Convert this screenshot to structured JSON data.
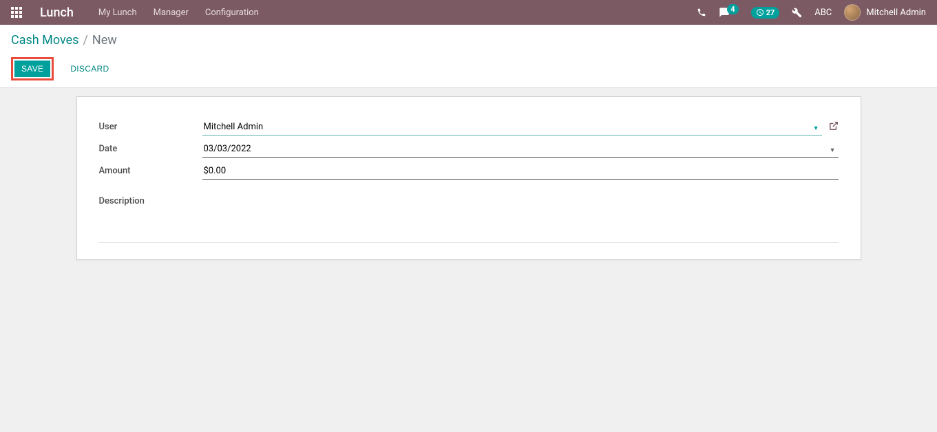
{
  "navbar": {
    "brand": "Lunch",
    "menu": [
      "My Lunch",
      "Manager",
      "Configuration"
    ],
    "messages_badge": "4",
    "activities_badge": "27",
    "company": "ABC",
    "username": "Mitchell Admin"
  },
  "breadcrumb": {
    "parent": "Cash Moves",
    "separator": "/",
    "current": "New"
  },
  "buttons": {
    "save": "SAVE",
    "discard": "DISCARD"
  },
  "form": {
    "labels": {
      "user": "User",
      "date": "Date",
      "amount": "Amount",
      "description": "Description"
    },
    "values": {
      "user": "Mitchell Admin",
      "date": "03/03/2022",
      "amount": "$0.00",
      "description": ""
    }
  }
}
